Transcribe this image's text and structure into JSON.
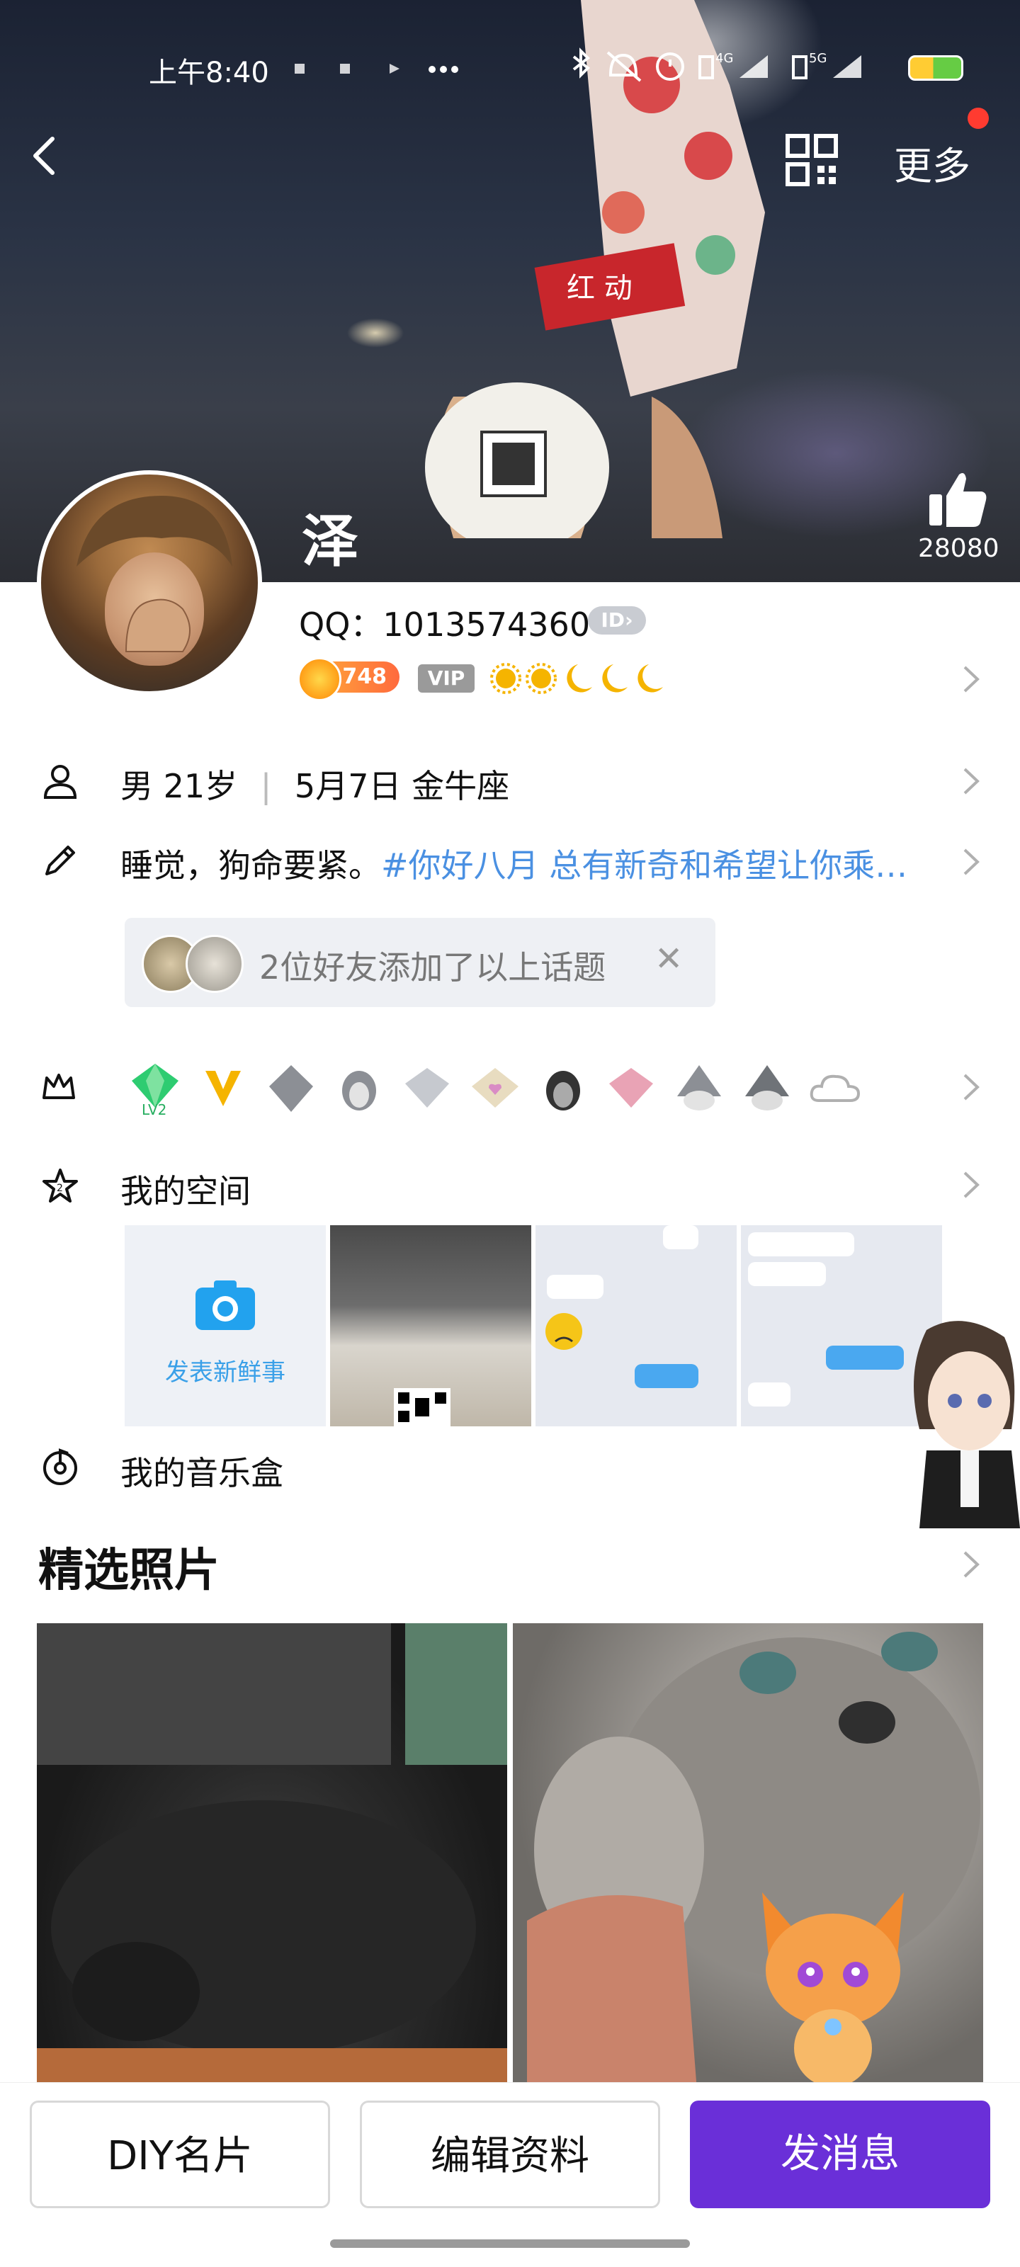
{
  "status_bar": {
    "time": "上午8:40",
    "network_labels": [
      "4G",
      "5G"
    ]
  },
  "header": {
    "more_label": "更多",
    "has_notification_dot": true
  },
  "profile": {
    "nickname": "泽",
    "like_count": "28080",
    "qq_label": "QQ：1013574360",
    "id_badge": "ID",
    "level": "748",
    "vip_label": "VIP",
    "gender": "男",
    "age": "21岁",
    "birthday": "5月7日",
    "zodiac": "金牛座",
    "signature_text": "睡觉，狗命要紧。",
    "signature_topic": "#你好八月 总有新奇和希望让你乘…",
    "topic_hint": "2位好友添加了以上话题"
  },
  "honors": {
    "icons": [
      "diamond-lv2-icon",
      "vip-v1-icon",
      "gray-gem-icon",
      "penguin-icon",
      "diamond-1-icon",
      "heart-gem-icon",
      "dark-penguin-icon",
      "pink-diamond-3-icon",
      "gray-penguin-icon",
      "gray-penguin-2-icon",
      "cloud-icon"
    ]
  },
  "space": {
    "title": "我的空间",
    "post_label": "发表新鲜事"
  },
  "music": {
    "title": "我的音乐盒"
  },
  "photos": {
    "title": "精选照片"
  },
  "actions": {
    "diy_card": "DIY名片",
    "edit_profile": "编辑资料",
    "send_message": "发消息"
  },
  "colors": {
    "primary": "#6a2fd8",
    "topic_link": "#4a90e2",
    "level_badge": "#ff8a2a",
    "notification_dot": "#ff3b30"
  }
}
